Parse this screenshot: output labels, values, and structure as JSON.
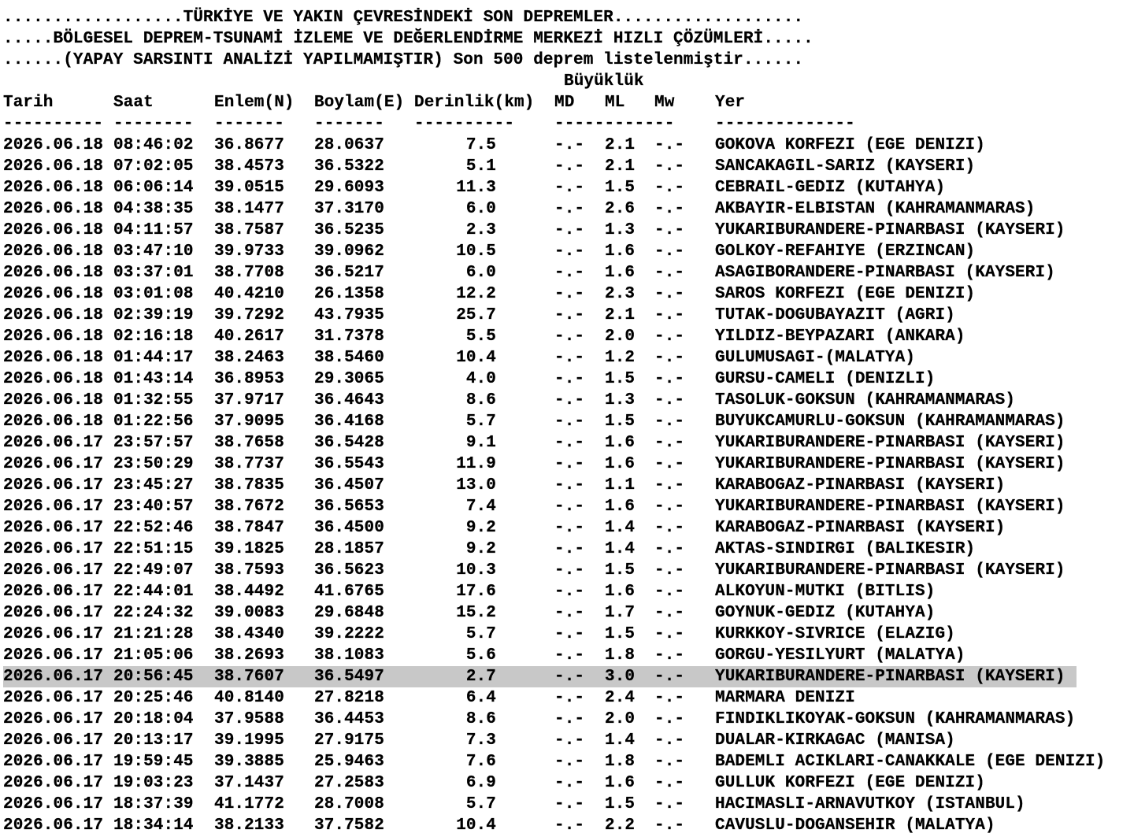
{
  "header": {
    "line1": "..................TÜRKİYE VE YAKIN ÇEVRESİNDEKİ SON DEPREMLER...................",
    "line2": ".....BÖLGESEL DEPREM-TSUNAMİ İZLEME VE DEĞERLENDİRME MERKEZİ HIZLI ÇÖZÜMLERİ.....",
    "line3": "......(YAPAY SARSINTI ANALİZİ YAPILMAMIŞTIR) Son 500 deprem listelenmiştir......",
    "magnitude_group_label": "Büyüklük"
  },
  "columns": {
    "date": "Tarih",
    "time": "Saat",
    "lat": "Enlem(N)",
    "lon": "Boylam(E)",
    "depth": "Derinlik(km)",
    "md": "MD",
    "ml": "ML",
    "mw": "Mw",
    "place": "Yer"
  },
  "dashes": {
    "date": "----------",
    "time": "--------",
    "lat": "-------",
    "lon": "-------",
    "depth": "----------",
    "mag": "------------",
    "place": "--------------"
  },
  "highlight_color": "#c8c8c8",
  "rows": [
    {
      "date": "2026.06.18",
      "time": "08:46:02",
      "lat": "36.8677",
      "lon": "28.0637",
      "depth": "7.5",
      "md": "-.-",
      "ml": "2.1",
      "mw": "-.-",
      "place": "GOKOVA KORFEZI (EGE DENIZI)"
    },
    {
      "date": "2026.06.18",
      "time": "07:02:05",
      "lat": "38.4573",
      "lon": "36.5322",
      "depth": "5.1",
      "md": "-.-",
      "ml": "2.1",
      "mw": "-.-",
      "place": "SANCAKAGIL-SARIZ (KAYSERI)"
    },
    {
      "date": "2026.06.18",
      "time": "06:06:14",
      "lat": "39.0515",
      "lon": "29.6093",
      "depth": "11.3",
      "md": "-.-",
      "ml": "1.5",
      "mw": "-.-",
      "place": "CEBRAIL-GEDIZ (KUTAHYA)"
    },
    {
      "date": "2026.06.18",
      "time": "04:38:35",
      "lat": "38.1477",
      "lon": "37.3170",
      "depth": "6.0",
      "md": "-.-",
      "ml": "2.6",
      "mw": "-.-",
      "place": "AKBAYIR-ELBISTAN (KAHRAMANMARAS)"
    },
    {
      "date": "2026.06.18",
      "time": "04:11:57",
      "lat": "38.7587",
      "lon": "36.5235",
      "depth": "2.3",
      "md": "-.-",
      "ml": "1.3",
      "mw": "-.-",
      "place": "YUKARIBURANDERE-PINARBASI (KAYSERI)"
    },
    {
      "date": "2026.06.18",
      "time": "03:47:10",
      "lat": "39.9733",
      "lon": "39.0962",
      "depth": "10.5",
      "md": "-.-",
      "ml": "1.6",
      "mw": "-.-",
      "place": "GOLKOY-REFAHIYE (ERZINCAN)"
    },
    {
      "date": "2026.06.18",
      "time": "03:37:01",
      "lat": "38.7708",
      "lon": "36.5217",
      "depth": "6.0",
      "md": "-.-",
      "ml": "1.6",
      "mw": "-.-",
      "place": "ASAGIBORANDERE-PINARBASI (KAYSERI)"
    },
    {
      "date": "2026.06.18",
      "time": "03:01:08",
      "lat": "40.4210",
      "lon": "26.1358",
      "depth": "12.2",
      "md": "-.-",
      "ml": "2.3",
      "mw": "-.-",
      "place": "SAROS KORFEZI (EGE DENIZI)"
    },
    {
      "date": "2026.06.18",
      "time": "02:39:19",
      "lat": "39.7292",
      "lon": "43.7935",
      "depth": "25.7",
      "md": "-.-",
      "ml": "2.1",
      "mw": "-.-",
      "place": "TUTAK-DOGUBAYAZIT (AGRI)"
    },
    {
      "date": "2026.06.18",
      "time": "02:16:18",
      "lat": "40.2617",
      "lon": "31.7378",
      "depth": "5.5",
      "md": "-.-",
      "ml": "2.0",
      "mw": "-.-",
      "place": "YILDIZ-BEYPAZARI (ANKARA)"
    },
    {
      "date": "2026.06.18",
      "time": "01:44:17",
      "lat": "38.2463",
      "lon": "38.5460",
      "depth": "10.4",
      "md": "-.-",
      "ml": "1.2",
      "mw": "-.-",
      "place": "GULUMUSAGI-(MALATYA)"
    },
    {
      "date": "2026.06.18",
      "time": "01:43:14",
      "lat": "36.8953",
      "lon": "29.3065",
      "depth": "4.0",
      "md": "-.-",
      "ml": "1.5",
      "mw": "-.-",
      "place": "GURSU-CAMELI (DENIZLI)"
    },
    {
      "date": "2026.06.18",
      "time": "01:32:55",
      "lat": "37.9717",
      "lon": "36.4643",
      "depth": "8.6",
      "md": "-.-",
      "ml": "1.3",
      "mw": "-.-",
      "place": "TASOLUK-GOKSUN (KAHRAMANMARAS)"
    },
    {
      "date": "2026.06.18",
      "time": "01:22:56",
      "lat": "37.9095",
      "lon": "36.4168",
      "depth": "5.7",
      "md": "-.-",
      "ml": "1.5",
      "mw": "-.-",
      "place": "BUYUKCAMURLU-GOKSUN (KAHRAMANMARAS)"
    },
    {
      "date": "2026.06.17",
      "time": "23:57:57",
      "lat": "38.7658",
      "lon": "36.5428",
      "depth": "9.1",
      "md": "-.-",
      "ml": "1.6",
      "mw": "-.-",
      "place": "YUKARIBURANDERE-PINARBASI (KAYSERI)"
    },
    {
      "date": "2026.06.17",
      "time": "23:50:29",
      "lat": "38.7737",
      "lon": "36.5543",
      "depth": "11.9",
      "md": "-.-",
      "ml": "1.6",
      "mw": "-.-",
      "place": "YUKARIBURANDERE-PINARBASI (KAYSERI)"
    },
    {
      "date": "2026.06.17",
      "time": "23:45:27",
      "lat": "38.7835",
      "lon": "36.4507",
      "depth": "13.0",
      "md": "-.-",
      "ml": "1.1",
      "mw": "-.-",
      "place": "KARABOGAZ-PINARBASI (KAYSERI)"
    },
    {
      "date": "2026.06.17",
      "time": "23:40:57",
      "lat": "38.7672",
      "lon": "36.5653",
      "depth": "7.4",
      "md": "-.-",
      "ml": "1.6",
      "mw": "-.-",
      "place": "YUKARIBURANDERE-PINARBASI (KAYSERI)"
    },
    {
      "date": "2026.06.17",
      "time": "22:52:46",
      "lat": "38.7847",
      "lon": "36.4500",
      "depth": "9.2",
      "md": "-.-",
      "ml": "1.4",
      "mw": "-.-",
      "place": "KARABOGAZ-PINARBASI (KAYSERI)"
    },
    {
      "date": "2026.06.17",
      "time": "22:51:15",
      "lat": "39.1825",
      "lon": "28.1857",
      "depth": "9.2",
      "md": "-.-",
      "ml": "1.4",
      "mw": "-.-",
      "place": "AKTAS-SINDIRGI (BALIKESIR)"
    },
    {
      "date": "2026.06.17",
      "time": "22:49:07",
      "lat": "38.7593",
      "lon": "36.5623",
      "depth": "10.3",
      "md": "-.-",
      "ml": "1.5",
      "mw": "-.-",
      "place": "YUKARIBURANDERE-PINARBASI (KAYSERI)"
    },
    {
      "date": "2026.06.17",
      "time": "22:44:01",
      "lat": "38.4492",
      "lon": "41.6765",
      "depth": "17.6",
      "md": "-.-",
      "ml": "1.6",
      "mw": "-.-",
      "place": "ALKOYUN-MUTKI (BITLIS)"
    },
    {
      "date": "2026.06.17",
      "time": "22:24:32",
      "lat": "39.0083",
      "lon": "29.6848",
      "depth": "15.2",
      "md": "-.-",
      "ml": "1.7",
      "mw": "-.-",
      "place": "GOYNUK-GEDIZ (KUTAHYA)"
    },
    {
      "date": "2026.06.17",
      "time": "21:21:28",
      "lat": "38.4340",
      "lon": "39.2222",
      "depth": "5.7",
      "md": "-.-",
      "ml": "1.5",
      "mw": "-.-",
      "place": "KURKKOY-SIVRICE (ELAZIG)"
    },
    {
      "date": "2026.06.17",
      "time": "21:05:06",
      "lat": "38.2693",
      "lon": "38.1083",
      "depth": "5.6",
      "md": "-.-",
      "ml": "1.8",
      "mw": "-.-",
      "place": "GORGU-YESILYURT (MALATYA)"
    },
    {
      "date": "2026.06.17",
      "time": "20:56:45",
      "lat": "38.7607",
      "lon": "36.5497",
      "depth": "2.7",
      "md": "-.-",
      "ml": "3.0",
      "mw": "-.-",
      "place": "YUKARIBURANDERE-PINARBASI (KAYSERI)",
      "highlighted": true
    },
    {
      "date": "2026.06.17",
      "time": "20:25:46",
      "lat": "40.8140",
      "lon": "27.8218",
      "depth": "6.4",
      "md": "-.-",
      "ml": "2.4",
      "mw": "-.-",
      "place": "MARMARA DENIZI"
    },
    {
      "date": "2026.06.17",
      "time": "20:18:04",
      "lat": "37.9588",
      "lon": "36.4453",
      "depth": "8.6",
      "md": "-.-",
      "ml": "2.0",
      "mw": "-.-",
      "place": "FINDIKLIKOYAK-GOKSUN (KAHRAMANMARAS)"
    },
    {
      "date": "2026.06.17",
      "time": "20:13:17",
      "lat": "39.1995",
      "lon": "27.9175",
      "depth": "7.3",
      "md": "-.-",
      "ml": "1.4",
      "mw": "-.-",
      "place": "DUALAR-KIRKAGAC (MANISA)"
    },
    {
      "date": "2026.06.17",
      "time": "19:59:45",
      "lat": "39.3885",
      "lon": "25.9463",
      "depth": "7.6",
      "md": "-.-",
      "ml": "1.8",
      "mw": "-.-",
      "place": "BADEMLI ACIKLARI-CANAKKALE (EGE DENIZI)"
    },
    {
      "date": "2026.06.17",
      "time": "19:03:23",
      "lat": "37.1437",
      "lon": "27.2583",
      "depth": "6.9",
      "md": "-.-",
      "ml": "1.6",
      "mw": "-.-",
      "place": "GULLUK KORFEZI (EGE DENIZI)"
    },
    {
      "date": "2026.06.17",
      "time": "18:37:39",
      "lat": "41.1772",
      "lon": "28.7008",
      "depth": "5.7",
      "md": "-.-",
      "ml": "1.5",
      "mw": "-.-",
      "place": "HACIMASLI-ARNAVUTKOY (ISTANBUL)"
    },
    {
      "date": "2026.06.17",
      "time": "18:34:14",
      "lat": "38.2133",
      "lon": "37.7582",
      "depth": "10.4",
      "md": "-.-",
      "ml": "2.2",
      "mw": "-.-",
      "place": "CAVUSLU-DOGANSEHIR (MALATYA)"
    }
  ]
}
